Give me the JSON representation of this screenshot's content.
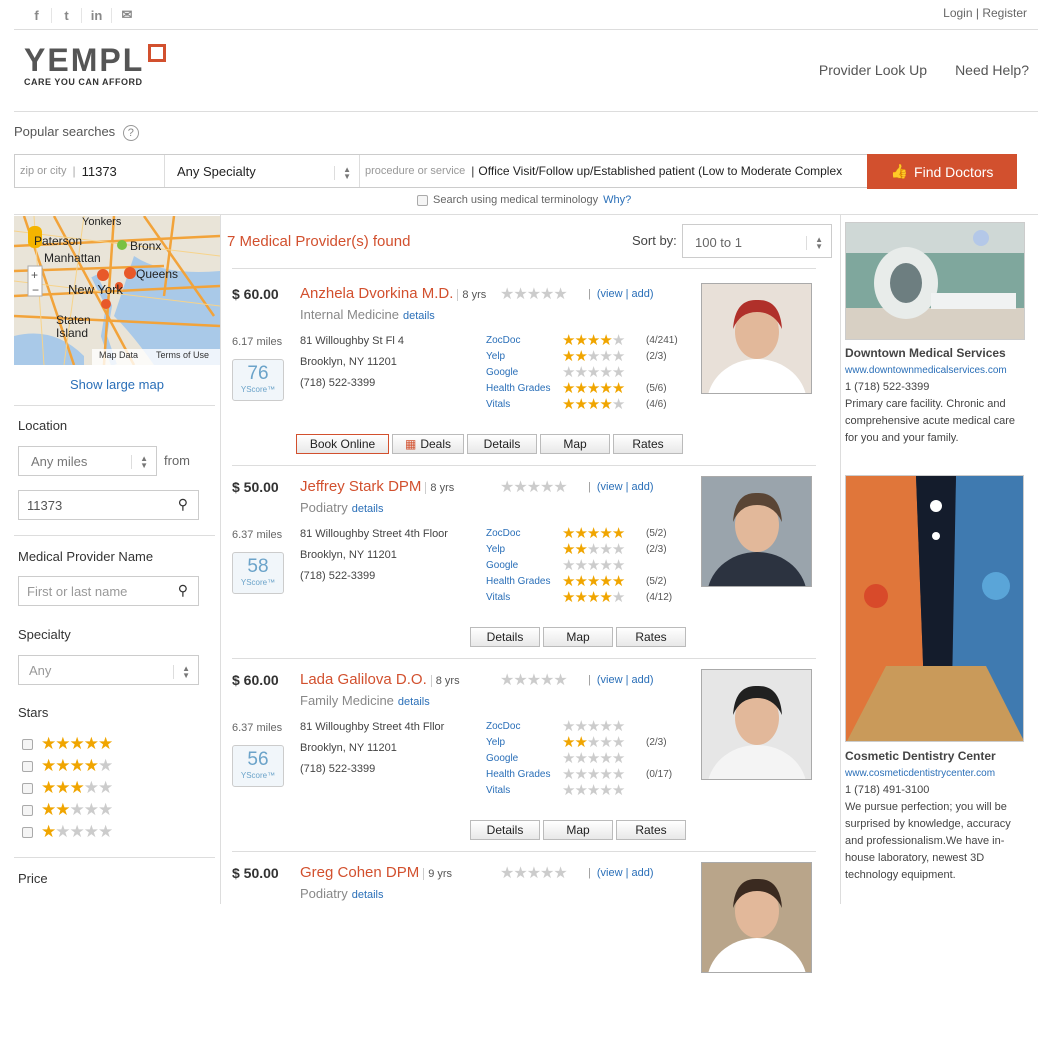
{
  "header": {
    "social": [
      "f",
      "t",
      "in",
      "✉"
    ],
    "login": "Login",
    "register": "Register",
    "logo_word": "YEMPL",
    "logo_tag": "CARE YOU CAN AFFORD",
    "nav": {
      "provider_lookup": "Provider Look Up",
      "need_help": "Need Help?"
    }
  },
  "search": {
    "popular_label": "Popular searches",
    "zip_label": "zip or city",
    "zip_value": "11373",
    "specialty": "Any Specialty",
    "procedure_label": "procedure or service",
    "procedure_value": "Office Visit/Follow up/Established patient (Low to Moderate Complex",
    "find_button": "Find Doctors",
    "medical_term": "Search using medical terminology",
    "why": "Why?"
  },
  "map": {
    "labels": [
      "Yonkers",
      "Paterson",
      "Bronx",
      "Manhattan",
      "Queens",
      "New York",
      "Staten",
      "Island"
    ],
    "map_data": "Map Data",
    "terms": "Terms of Use",
    "show_large": "Show large map"
  },
  "filters": {
    "location_label": "Location",
    "miles": "Any miles",
    "from": "from",
    "zip": "11373",
    "provider_name_label": "Medical Provider Name",
    "provider_name_placeholder": "First or last name",
    "specialty_label": "Specialty",
    "specialty_value": "Any",
    "stars_label": "Stars",
    "stars_options": [
      5,
      4,
      3,
      2,
      1
    ],
    "price_label": "Price"
  },
  "results": {
    "count_text": "7 Medical Provider(s) found",
    "sort_label": "Sort by:",
    "sort_value": "100 to 1",
    "view": "(view",
    "add": "add)",
    "details_link": "details",
    "buttons": {
      "book": "Book Online",
      "deals": "Deals",
      "details": "Details",
      "map": "Map",
      "rates": "Rates"
    },
    "items": [
      {
        "price": "$ 60.00",
        "name": "Anzhela Dvorkina M.D.",
        "years": "8 yrs",
        "specialty": "Internal Medicine",
        "miles": "6.17 miles",
        "yscore": "76",
        "yscore_label": "YScore™",
        "address1": "81 Willoughby St Fl 4",
        "address2": "Brooklyn, NY 11201",
        "phone": "(718) 522-3399",
        "ratings": [
          {
            "source": "ZocDoc",
            "stars": 4,
            "count": "(4/241)"
          },
          {
            "source": "Yelp",
            "stars": 2,
            "count": "(2/3)"
          },
          {
            "source": "Google",
            "stars": 0,
            "count": ""
          },
          {
            "source": "Health Grades",
            "stars": 5,
            "count": "(5/6)"
          },
          {
            "source": "Vitals",
            "stars": 4,
            "count": "(4/6)"
          }
        ],
        "photo_bg": "#e8e0d8",
        "photo_shirt": "#ffffff",
        "photo_hair": "#b0302a"
      },
      {
        "price": "$ 50.00",
        "name": "Jeffrey Stark DPM",
        "years": "8 yrs",
        "specialty": "Podiatry",
        "miles": "6.37 miles",
        "yscore": "58",
        "yscore_label": "YScore™",
        "address1": "81 Willoughby Street 4th Floor",
        "address2": "Brooklyn, NY 11201",
        "phone": "(718) 522-3399",
        "ratings": [
          {
            "source": "ZocDoc",
            "stars": 5,
            "count": "(5/2)"
          },
          {
            "source": "Yelp",
            "stars": 2,
            "count": "(2/3)"
          },
          {
            "source": "Google",
            "stars": 0,
            "count": ""
          },
          {
            "source": "Health Grades",
            "stars": 5,
            "count": "(5/2)"
          },
          {
            "source": "Vitals",
            "stars": 4,
            "count": "(4/12)"
          }
        ],
        "photo_bg": "#9aa4ac",
        "photo_shirt": "#2c3340",
        "photo_hair": "#5a4535"
      },
      {
        "price": "$ 60.00",
        "name": "Lada Galilova D.O.",
        "years": "8 yrs",
        "specialty": "Family Medicine",
        "miles": "6.37 miles",
        "yscore": "56",
        "yscore_label": "YScore™",
        "address1": "81 Willoughby Street 4th Fllor",
        "address2": "Brooklyn, NY 11201",
        "phone": "(718) 522-3399",
        "ratings": [
          {
            "source": "ZocDoc",
            "stars": 0,
            "count": ""
          },
          {
            "source": "Yelp",
            "stars": 2,
            "count": "(2/3)"
          },
          {
            "source": "Google",
            "stars": 0,
            "count": ""
          },
          {
            "source": "Health Grades",
            "stars": 0,
            "count": "(0/17)"
          },
          {
            "source": "Vitals",
            "stars": 0,
            "count": ""
          }
        ],
        "photo_bg": "#e6e6e6",
        "photo_shirt": "#f4f4f4",
        "photo_hair": "#202020"
      },
      {
        "price": "$ 50.00",
        "name": "Greg Cohen DPM",
        "years": "9 yrs",
        "specialty": "Podiatry",
        "photo_bg": "#b9a58a",
        "photo_shirt": "#ffffff",
        "photo_hair": "#3a2a20"
      }
    ]
  },
  "sidebar_ads": [
    {
      "title": "Downtown Medical Services",
      "url": "www.downtownmedicalservices.com",
      "phone": "1 (718) 522-3399",
      "desc": "Primary care facility. Chronic and comprehensive acute medical care for you and your family."
    },
    {
      "title": "Cosmetic Dentistry Center",
      "url": "www.cosmeticdentistrycenter.com",
      "phone": "1 (718) 491-3100",
      "desc": "We pursue perfection; you will be surprised by knowledge, accuracy and professionalism.We have in-house laboratory, newest 3D technology equipment."
    }
  ],
  "colors": {
    "accent": "#d2502e",
    "link": "#2a6fb8",
    "star": "#f0a500"
  }
}
